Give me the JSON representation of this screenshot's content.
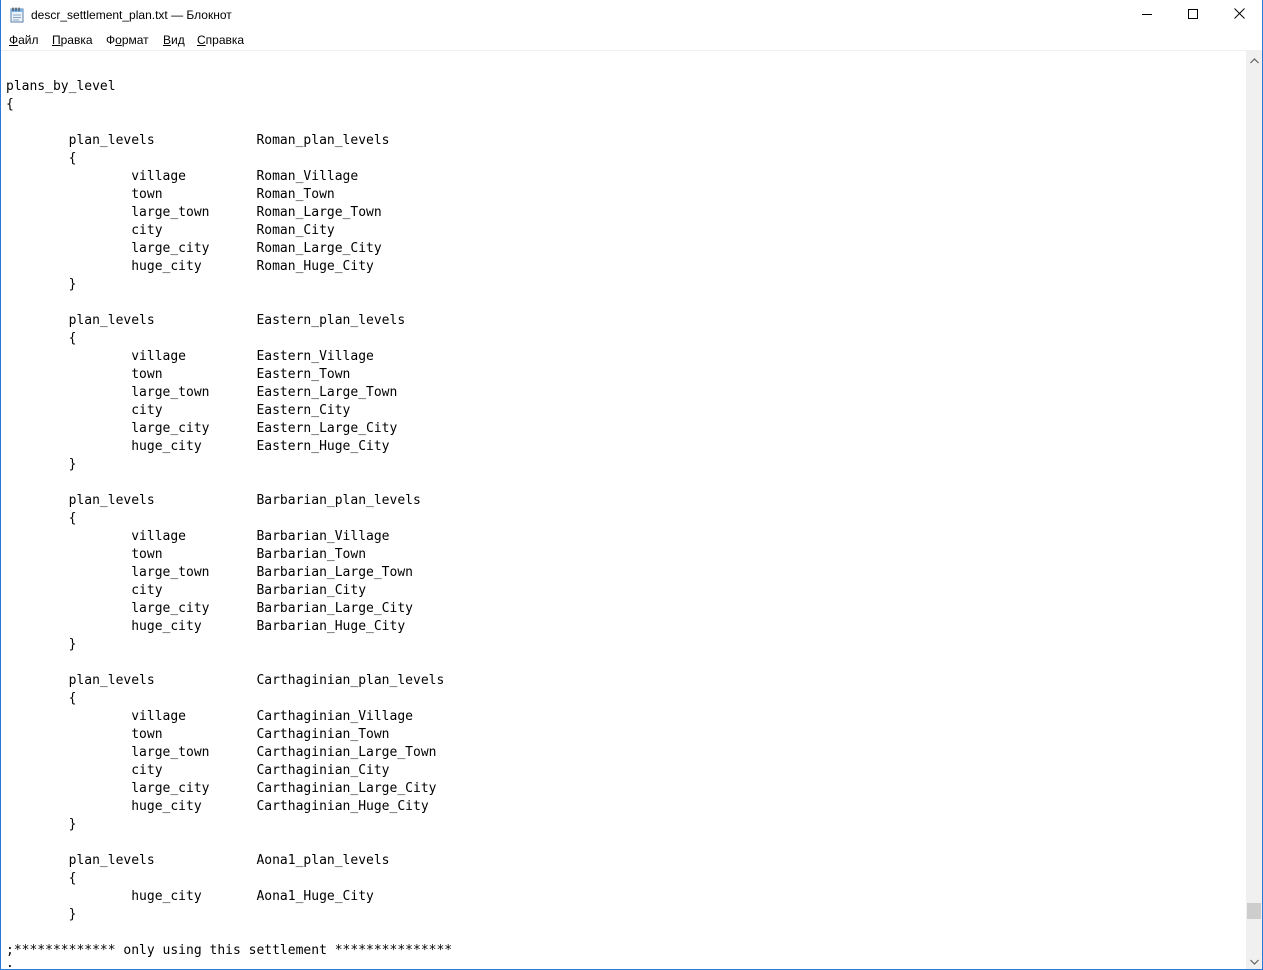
{
  "window": {
    "title": "descr_settlement_plan.txt — Блокнот",
    "icon": "notepad-icon",
    "controls": {
      "minimize": "minimize-icon",
      "maximize": "maximize-icon",
      "close": "close-icon"
    }
  },
  "menu": {
    "file": {
      "hotkey": "Ф",
      "rest": "айл"
    },
    "edit": {
      "hotkey": "П",
      "rest": "равка"
    },
    "format": {
      "pre": "Ф",
      "hotkey": "о",
      "rest": "рмат"
    },
    "view": {
      "hotkey": "В",
      "rest": "ид"
    },
    "help": {
      "hotkey": "С",
      "rest": "правка"
    }
  },
  "editor": {
    "lines": [
      "",
      "plans_by_level",
      "{",
      "",
      "        plan_levels             Roman_plan_levels",
      "        {",
      "                village         Roman_Village",
      "                town            Roman_Town",
      "                large_town      Roman_Large_Town",
      "                city            Roman_City",
      "                large_city      Roman_Large_City",
      "                huge_city       Roman_Huge_City",
      "        }",
      "",
      "        plan_levels             Eastern_plan_levels",
      "        {",
      "                village         Eastern_Village",
      "                town            Eastern_Town",
      "                large_town      Eastern_Large_Town",
      "                city            Eastern_City",
      "                large_city      Eastern_Large_City",
      "                huge_city       Eastern_Huge_City",
      "        }",
      "",
      "        plan_levels             Barbarian_plan_levels",
      "        {",
      "                village         Barbarian_Village",
      "                town            Barbarian_Town",
      "                large_town      Barbarian_Large_Town",
      "                city            Barbarian_City",
      "                large_city      Barbarian_Large_City",
      "                huge_city       Barbarian_Huge_City",
      "        }",
      "",
      "        plan_levels             Carthaginian_plan_levels",
      "        {",
      "                village         Carthaginian_Village",
      "                town            Carthaginian_Town",
      "                large_town      Carthaginian_Large_Town",
      "                city            Carthaginian_City",
      "                large_city      Carthaginian_Large_City",
      "                huge_city       Carthaginian_Huge_City",
      "        }",
      "",
      "        plan_levels             Aona1_plan_levels",
      "        {",
      "                huge_city       Aona1_Huge_City",
      "        }",
      "",
      ";************* only using this settlement ***************",
      ";"
    ]
  },
  "scrollbar": {
    "up_icon": "scroll-up-arrow-icon",
    "down_icon": "scroll-down-arrow-icon",
    "position_fraction": 0.98
  },
  "colors": {
    "border": "#2b79d8",
    "scroll_track": "#f0f0f0",
    "scroll_thumb": "#cdcdcd"
  }
}
